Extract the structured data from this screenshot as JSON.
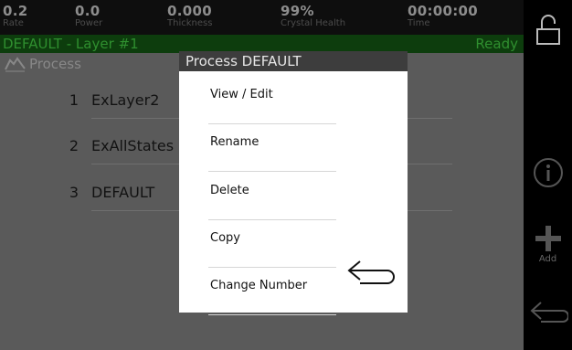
{
  "status": {
    "rate": {
      "value": "0.2",
      "label": "Rate"
    },
    "power": {
      "value": "0.0",
      "label": "Power"
    },
    "thickness": {
      "value": "0.000",
      "label": "Thickness"
    },
    "crystal": {
      "value": "99%",
      "label": "Crystal Health"
    },
    "time": {
      "value": "00:00:00",
      "label": "Time"
    }
  },
  "layer": {
    "name": "DEFAULT - Layer #1",
    "state": "Ready"
  },
  "section_title": "Process",
  "processes": [
    {
      "number": "1",
      "name": "ExLayer2"
    },
    {
      "number": "2",
      "name": "ExAllStates"
    },
    {
      "number": "3",
      "name": "DEFAULT"
    }
  ],
  "popup": {
    "title": "Process DEFAULT",
    "items": [
      "View / Edit",
      "Rename",
      "Delete",
      "Copy",
      "Change Number"
    ]
  },
  "sidebar": {
    "add_label": "Add"
  },
  "icons": {
    "lock": "lock-open-icon",
    "info": "info-icon",
    "add": "plus-icon",
    "back": "back-arrow-icon",
    "process": "process-graph-icon"
  },
  "colors": {
    "status_green": "#2f8f2f",
    "dim_bg": "#5a5a5a",
    "popup_title_bg": "#3d3d3d"
  }
}
